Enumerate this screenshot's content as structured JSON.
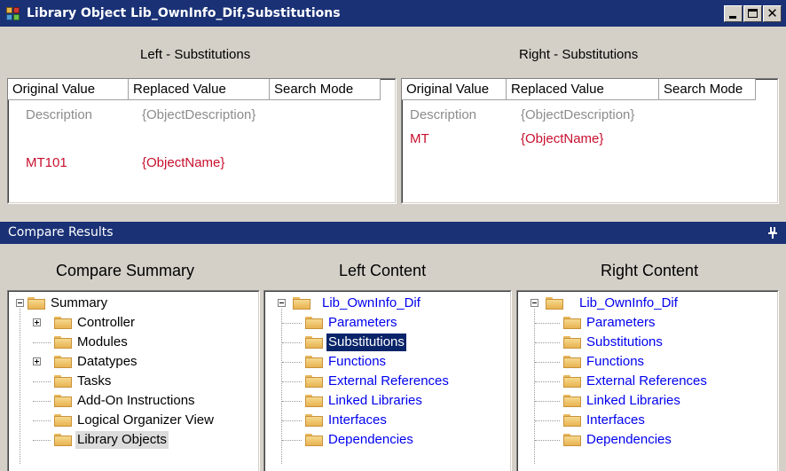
{
  "window": {
    "title": "Library Object Lib_OwnInfo_Dif,Substitutions"
  },
  "left_pane": {
    "title": "Left - Substitutions",
    "columns": [
      "Original Value",
      "Replaced Value",
      "Search Mode"
    ],
    "rows": [
      {
        "original": "Description",
        "replaced": "{ObjectDescription}",
        "mode": "",
        "style": "gray"
      },
      {
        "original": "MT101",
        "replaced": "{ObjectName}",
        "mode": "",
        "style": "red"
      }
    ]
  },
  "right_pane": {
    "title": "Right - Substitutions",
    "columns": [
      "Original Value",
      "Replaced Value",
      "Search Mode"
    ],
    "rows": [
      {
        "original": "Description",
        "replaced": "{ObjectDescription}",
        "mode": "",
        "style": "gray"
      },
      {
        "original": "MT",
        "replaced": "{ObjectName}",
        "mode": "",
        "style": "red"
      }
    ]
  },
  "compare_results": {
    "title": "Compare Results",
    "columns": {
      "summary": "Compare Summary",
      "left": "Left Content",
      "right": "Right Content"
    }
  },
  "summary_tree": {
    "root": "Summary",
    "items": [
      "Controller",
      "Modules",
      "Datatypes",
      "Tasks",
      "Add-On Instructions",
      "Logical Organizer View",
      "Library Objects"
    ]
  },
  "left_tree": {
    "root": "Lib_OwnInfo_Dif",
    "items": [
      "Parameters",
      "Substitutions",
      "Functions",
      "External References",
      "Linked Libraries",
      "Interfaces",
      "Dependencies"
    ],
    "selected": "Substitutions"
  },
  "right_tree": {
    "root": "Lib_OwnInfo_Dif",
    "items": [
      "Parameters",
      "Substitutions",
      "Functions",
      "External References",
      "Linked Libraries",
      "Interfaces",
      "Dependencies"
    ]
  },
  "colors": {
    "titlebar": "#1a3176",
    "changed_text": "#c8102e",
    "unchanged_text": "#8c8c8c",
    "link_text": "#0000ee",
    "selection": "#0a246a"
  }
}
